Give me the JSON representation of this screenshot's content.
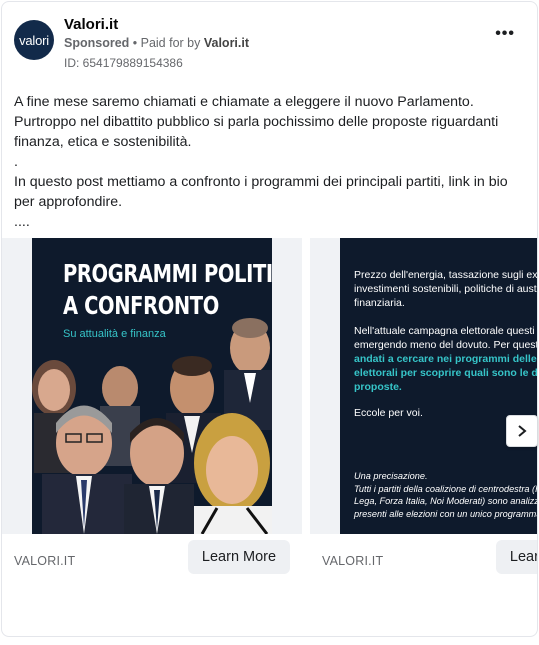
{
  "ad": {
    "page_name": "Valori.it",
    "avatar_text": "valori",
    "sponsored": "Sponsored",
    "paid_for_prefix": " • Paid for by ",
    "advertiser": "Valori.it",
    "library_id": "ID: 654179889154386",
    "more_label": "•••",
    "body": "A fine mese saremo chiamati e chiamate a eleggere il nuovo Parlamento.\nPurtroppo nel dibattito pubblico si parla pochissimo delle proposte riguardanti finanza, etica e sostenibilità.\n.\nIn questo post mettiamo a confronto i programmi dei principali partiti, link in bio per approfondire.\n...."
  },
  "carousel": {
    "cards": [
      {
        "poster_title_line1": "PROGRAMMI POLITICI",
        "poster_title_line2": "A CONFRONTO",
        "poster_subtitle": "Su attualità e finanza",
        "domain": "VALORI.IT",
        "cta": "Learn More"
      },
      {
        "para1": "Prezzo dell'energia, tassazione sugli extra profitti, investimenti sostenibili, politiche di austerity, tassazione finanziaria.",
        "para2_start": "Nell'attuale campagna elettorale questi temi stanno emergendo meno del dovuto. Per questo motivi ",
        "para2_highlight": "siamo andati a cercare nei programmi delle principali liste elettorali per scoprire quali sono le differenti proposte.",
        "para3": "Eccole per voi.",
        "note": "Una precisazione.\nTutti i partiti della coalizione di centrodestra (Fratelli d'Italia, Lega, Forza Italia, Noi Moderati) sono analizzati insieme perché presenti alle elezioni con un unico programma condiviso.",
        "domain": "VALORI.IT",
        "cta": "Learn More"
      }
    ],
    "next_icon": "chevron-right-icon"
  },
  "colors": {
    "poster_bg": "#0e1a2c",
    "accent_teal": "#36c4c8",
    "cta_bg": "#eef0f3"
  }
}
